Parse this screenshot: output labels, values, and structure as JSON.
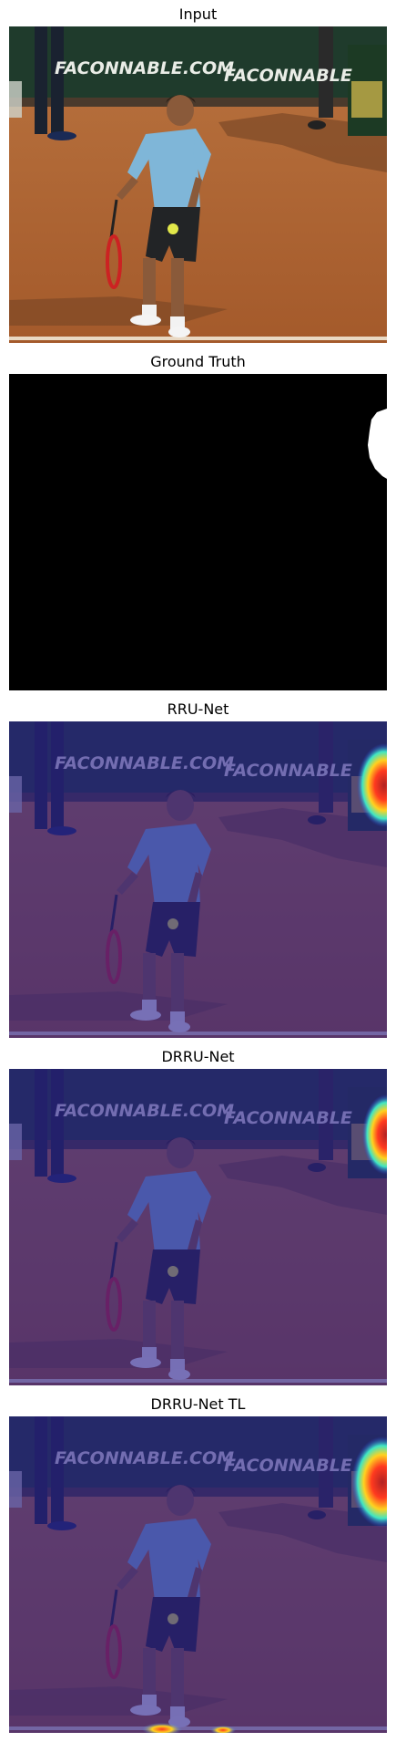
{
  "panels": [
    {
      "title": "Input",
      "kind": "input"
    },
    {
      "title": "Ground Truth",
      "kind": "mask"
    },
    {
      "title": "RRU-Net",
      "kind": "heatmap"
    },
    {
      "title": "DRRU-Net",
      "kind": "heatmap"
    },
    {
      "title": "DRRU-Net TL",
      "kind": "heatmap-tl"
    }
  ],
  "banner": {
    "left_text": "FACONNABLE.COM",
    "right_text": "FACONNABLE"
  },
  "colors": {
    "clay": "#b86a38",
    "banner": "#1f3b2c",
    "shirt": "#7fb6d8",
    "mask_bg": "#000000",
    "mask_fg": "#ffffff",
    "heat_tint": "#2a1f8f"
  }
}
